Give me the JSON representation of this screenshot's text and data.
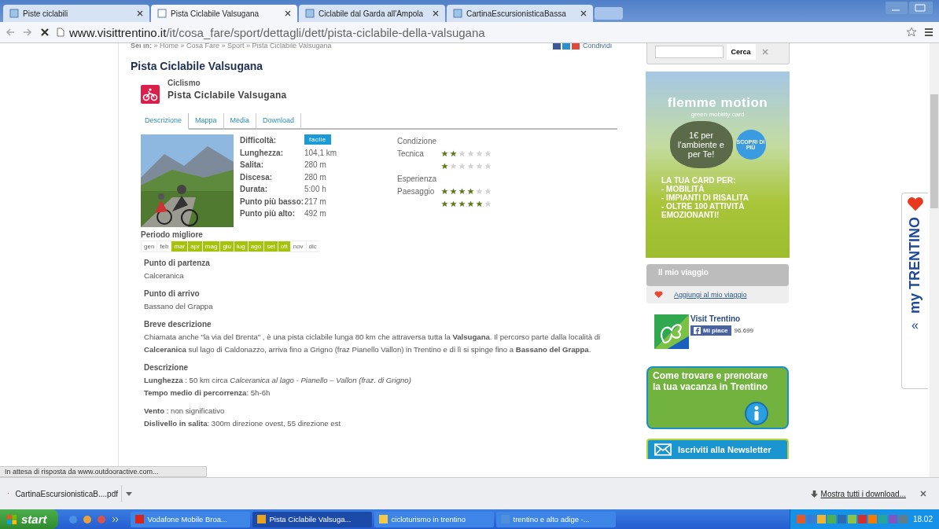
{
  "browser": {
    "tabs": [
      {
        "title": "Piste ciclabili",
        "selected": false
      },
      {
        "title": "Pista Ciclabile Valsugana",
        "selected": true
      },
      {
        "title": "Ciclabile dal Garda all'Ampola",
        "selected": false
      },
      {
        "title": "CartinaEscursionisticaBassa",
        "selected": false
      }
    ],
    "url_host": "www.visittrentino.it",
    "url_path": "/it/cosa_fare/sport/dettagli/dett/pista-ciclabile-della-valsugana"
  },
  "breadcrumb": "**Sei in:** » Home » Cosa Fare » Sport » Pista Ciclabile Valsugana",
  "share": "Condividi",
  "title": "Pista Ciclabile Valsugana",
  "category": "Ciclismo",
  "subtitle": "Pista Ciclabile Valsugana",
  "content_tabs": [
    {
      "label": "Descrizione",
      "selected": true
    },
    {
      "label": "Mappa",
      "selected": false
    },
    {
      "label": "Media",
      "selected": false
    },
    {
      "label": "Download",
      "selected": false
    }
  ],
  "details": [
    {
      "label": "Difficoltà:",
      "value": "facile",
      "kind": "badge"
    },
    {
      "label": "Lunghezza:",
      "value": "104,1 km",
      "kind": "text"
    },
    {
      "label": "Salita:",
      "value": "280 m",
      "kind": "text"
    },
    {
      "label": "Discesa:",
      "value": "280 m",
      "kind": "text"
    },
    {
      "label": "Durata:",
      "value": "5:00 h",
      "kind": "text"
    },
    {
      "label": "Punto più basso:",
      "value": "217 m",
      "kind": "text"
    },
    {
      "label": "Punto più alto:",
      "value": "492 m",
      "kind": "text"
    }
  ],
  "ratings": [
    {
      "heading": "Condizione",
      "label": "Tecnica",
      "rows": [
        {
          "stars": 2
        },
        {
          "stars": 1
        }
      ]
    },
    {
      "heading": "Esperienza",
      "label": "Paesaggio",
      "rows": [
        {
          "stars": 4
        },
        {
          "stars": 5
        }
      ]
    }
  ],
  "period": {
    "title": "Periodo migliore",
    "months": [
      {
        "label": "gen",
        "selected": false
      },
      {
        "label": "feb",
        "selected": false
      },
      {
        "label": "mar",
        "selected": true
      },
      {
        "label": "apr",
        "selected": true
      },
      {
        "label": "mag",
        "selected": true
      },
      {
        "label": "giu",
        "selected": true
      },
      {
        "label": "lug",
        "selected": true
      },
      {
        "label": "ago",
        "selected": true
      },
      {
        "label": "set",
        "selected": true
      },
      {
        "label": "ott",
        "selected": true
      },
      {
        "label": "nov",
        "selected": false
      },
      {
        "label": "dic",
        "selected": false
      }
    ]
  },
  "sections": [
    {
      "heading": "Punto di partenza",
      "lines": [
        "Calceranica"
      ]
    },
    {
      "heading": "Punto di arrivo",
      "lines": [
        "Bassano del Grappa"
      ]
    },
    {
      "heading": "Breve descrizione",
      "lines": [
        "Chiamata anche \"la via del Brenta\" , è una pista ciclabile lunga 80 km che attraversa tutta la **Valsugana**. Il percorso parte dalla località di **Calceranica** sul lago di Caldonazzo, arriva fino a Grigno (fraz Pianello Vallon)  in Trentino e di lì si spinge fino a **Bassano del Grappa**."
      ]
    },
    {
      "heading": "Descrizione",
      "lines": [
        "**Lunghezza** : 50 km circa *Calceranica al lago - Pianello – Vallon (fraz. di Grigno)*",
        "**Tempo medio di percorrenza**: 5h-6h"
      ]
    },
    {
      "lines": [
        "**Vento** : non significativo",
        "**Dislivello in salita**: 300m direzione ovest, 55 direzione est"
      ]
    }
  ],
  "sidebar": {
    "search_button": "Cerca",
    "ad": {
      "brand": "flemme motion",
      "tagline": "green mobility card",
      "slogan": "1€ per l'ambiente e per Te!",
      "badge": "SCOPRI DI PIÙ",
      "lines": [
        "LA TUA CARD PER:",
        "- MOBILITÀ",
        "- IMPIANTI DI RISALITA",
        "- OLTRE 100 ATTIVITÀ",
        "EMOZIONANTI!"
      ]
    },
    "trip_title": "Il mio viaggio",
    "trip_link": "Aggiungi al mio viaggio",
    "facebook": {
      "name": "Visit Trentino",
      "like": "Mi piace",
      "count": "96.699"
    },
    "booking": "Come trovare e prenotare la tua vacanza in Trentino",
    "newsletter": "Iscriviti alla Newsletter"
  },
  "my_trentino": {
    "label": "my TRENTINO",
    "arrow": "«"
  },
  "status": "In attesa di risposta da www.outdooractive.com...",
  "download": {
    "file": "CartinaEscursionisticaB....pdf",
    "show_all": "Mostra tutti i download..."
  },
  "taskbar": {
    "start": "start",
    "items": [
      {
        "title": "Vodafone Mobile Broa...",
        "selected": false,
        "color": "#d9261c"
      },
      {
        "title": "Pista Ciclabile Valsuga...",
        "selected": true,
        "color": "#e8a323"
      },
      {
        "title": "cicloturismo in trentino",
        "selected": false,
        "color": "#f2c94c"
      },
      {
        "title": "trentino e alto adige -...",
        "selected": false,
        "color": "#4f8fd8"
      }
    ],
    "clock": "18.02"
  }
}
